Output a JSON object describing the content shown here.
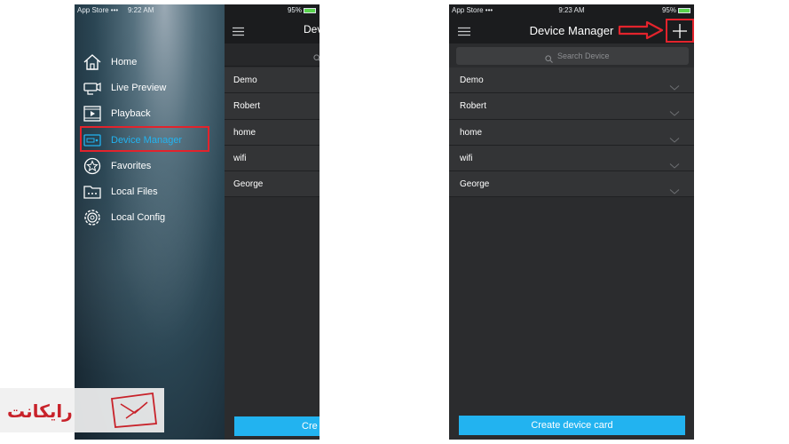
{
  "phone1": {
    "status": {
      "left": "App Store •••",
      "time": "9:22 AM",
      "battery": "95%"
    },
    "menu": [
      {
        "label": "Home",
        "icon": "home-icon"
      },
      {
        "label": "Live Preview",
        "icon": "camera-icon"
      },
      {
        "label": "Playback",
        "icon": "playback-icon"
      },
      {
        "label": "Device Manager",
        "icon": "device-manager-icon"
      },
      {
        "label": "Favorites",
        "icon": "star-icon"
      },
      {
        "label": "Local Files",
        "icon": "folder-icon"
      },
      {
        "label": "Local Config",
        "icon": "gear-icon"
      }
    ],
    "header_title": "Dev",
    "devices": [
      "Demo",
      "Robert",
      "home",
      "wifi",
      "George"
    ],
    "button": "Cre"
  },
  "phone2": {
    "status": {
      "left": "App Store •••",
      "time": "9:23 AM",
      "battery": "95%"
    },
    "title": "Device Manager",
    "search_placeholder": "Search Device",
    "devices": [
      "Demo",
      "Robert",
      "home",
      "wifi",
      "George"
    ],
    "button": "Create device card"
  },
  "watermark": {
    "text": "رایکانت"
  },
  "colors": {
    "accent": "#22b3f0",
    "highlight": "#e3232c",
    "panel": "#2b2c2e",
    "bar": "#1b1c1e"
  }
}
